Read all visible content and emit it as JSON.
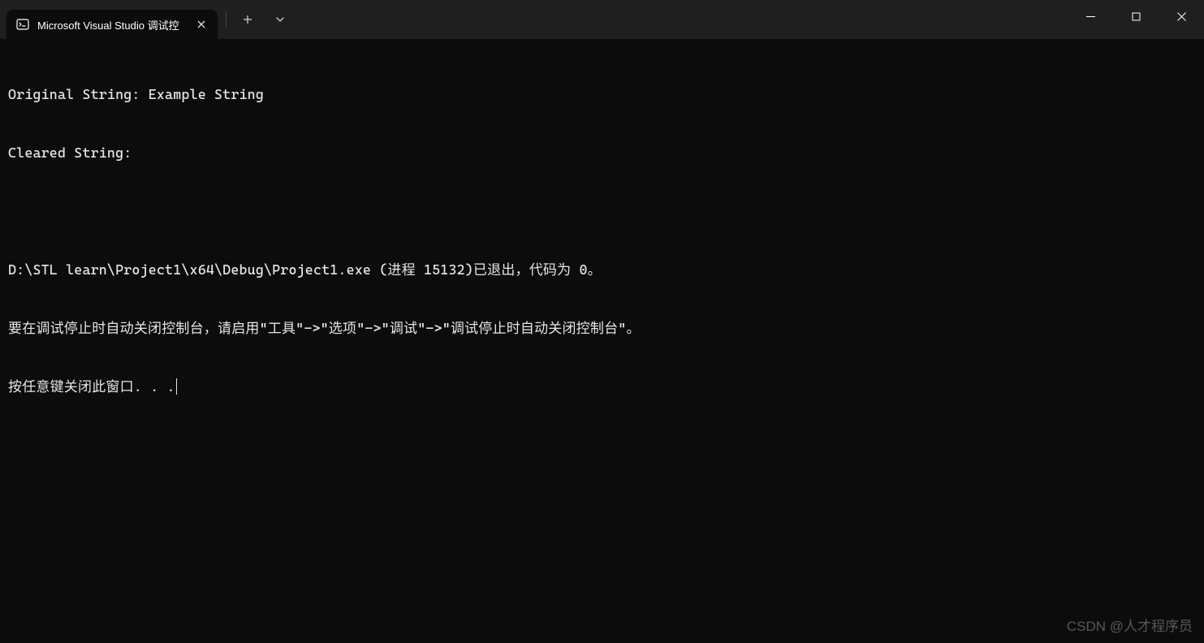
{
  "titlebar": {
    "tab": {
      "title": "Microsoft Visual Studio 调试控",
      "icon_name": "terminal-icon"
    }
  },
  "terminal": {
    "lines": [
      "Original String: Example String",
      "Cleared String:",
      "",
      "D:\\STL learn\\Project1\\x64\\Debug\\Project1.exe (进程 15132)已退出，代码为 0。",
      "要在调试停止时自动关闭控制台，请启用\"工具\"->\"选项\"->\"调试\"->\"调试停止时自动关闭控制台\"。",
      "按任意键关闭此窗口. . ."
    ]
  },
  "watermark": "CSDN @人才程序员"
}
